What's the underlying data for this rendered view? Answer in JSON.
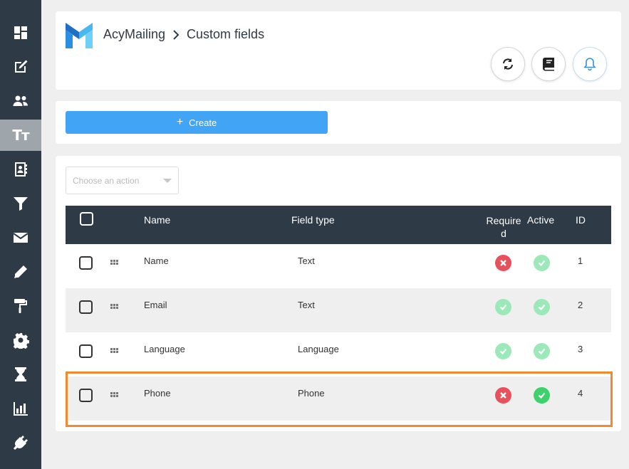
{
  "app": {
    "breadcrumb_root": "AcyMailing",
    "breadcrumb_page": "Custom fields"
  },
  "sidebar": {
    "items": [
      {
        "icon": "dashboard-icon"
      },
      {
        "icon": "edit-icon"
      },
      {
        "icon": "users-icon"
      },
      {
        "icon": "text-fields-icon",
        "active": true,
        "glyph": "Tт"
      },
      {
        "icon": "address-book-icon"
      },
      {
        "icon": "filter-icon"
      },
      {
        "icon": "envelope-icon"
      },
      {
        "icon": "pencil-icon"
      },
      {
        "icon": "paint-roller-icon"
      },
      {
        "icon": "gear-icon"
      },
      {
        "icon": "hourglass-icon"
      },
      {
        "icon": "bar-chart-icon"
      },
      {
        "icon": "plug-icon"
      }
    ]
  },
  "header_actions": [
    {
      "icon": "refresh-icon"
    },
    {
      "icon": "book-icon"
    },
    {
      "icon": "bell-icon"
    }
  ],
  "toolbar": {
    "create_label": "Create",
    "create_icon": "+"
  },
  "bulk_action": {
    "placeholder": "Choose an action"
  },
  "table": {
    "headers": {
      "name": "Name",
      "field_type": "Field type",
      "required": "Require d",
      "active": "Active",
      "id": "ID"
    },
    "rows": [
      {
        "name": "Name",
        "type": "Text",
        "required": false,
        "active": true,
        "id": "1"
      },
      {
        "name": "Email",
        "type": "Text",
        "required": true,
        "active": true,
        "id": "2"
      },
      {
        "name": "Language",
        "type": "Language",
        "required": true,
        "active": true,
        "id": "3"
      },
      {
        "name": "Phone",
        "type": "Phone",
        "required": false,
        "active": true,
        "id": "4"
      }
    ]
  },
  "colors": {
    "sidebar_bg": "#2e3a45",
    "accent_blue": "#42a4f5",
    "error_red": "#e8505b",
    "success_green": "#3dd16b",
    "muted_green": "#9be8b8",
    "highlight_orange": "#f0892f"
  }
}
